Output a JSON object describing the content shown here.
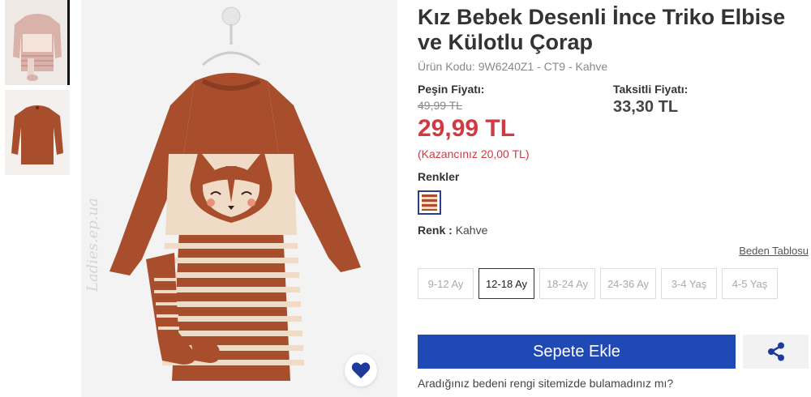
{
  "product": {
    "title": "Kız Bebek Desenli İnce Triko Elbise ve Külotlu Çorap",
    "code_line": "Ürün Kodu: 9W6240Z1 - CT9 - Kahve"
  },
  "price": {
    "cash_label": "Peşin Fiyatı:",
    "old_price": "49,99 TL",
    "new_price": "29,99 TL",
    "saving": "(Kazancınız 20,00 TL)",
    "installment_label": "Taksitli Fiyatı:",
    "installment_price": "33,30 TL"
  },
  "colors": {
    "label": "Renkler",
    "selected_label": "Renk :",
    "selected_value": "Kahve"
  },
  "sizes": {
    "table_link": "Beden Tablosu",
    "options": [
      "9-12 Ay",
      "12-18 Ay",
      "18-24 Ay",
      "24-36 Ay",
      "3-4 Yaş",
      "4-5 Yaş"
    ],
    "selected": "12-18 Ay"
  },
  "actions": {
    "add_to_cart": "Sepete Ekle",
    "not_found": "Aradığınız bedeni rengi sitemizde bulamadınız mı?"
  },
  "gallery": {
    "watermark": "Ladies.ep.ua"
  },
  "icons": {
    "favorite": "heart-icon",
    "share": "share-icon"
  },
  "theme": {
    "accent": "#1f4ab5",
    "price_red": "#d03b43",
    "dress_brown": "#a94e2c",
    "dress_cream": "#f0dcc6"
  }
}
